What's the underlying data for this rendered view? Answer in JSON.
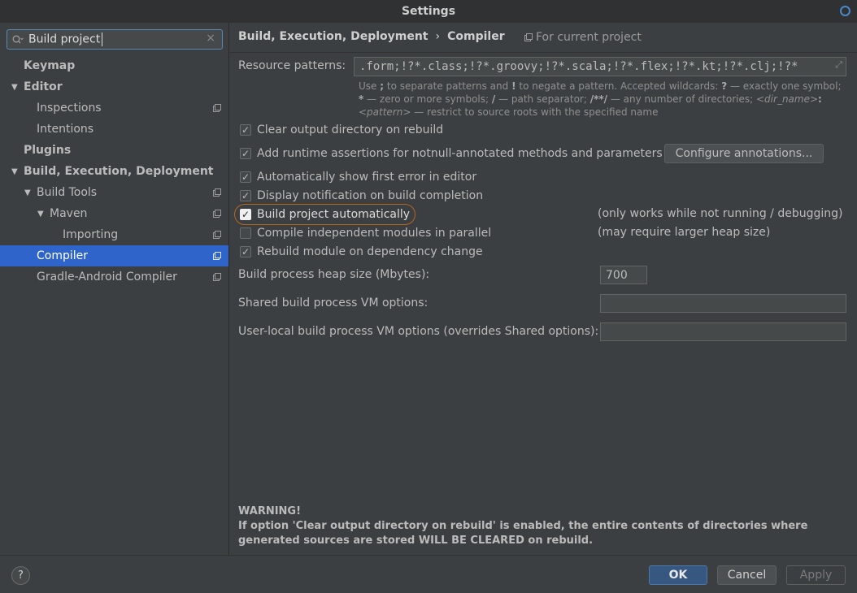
{
  "window": {
    "title": "Settings"
  },
  "search": {
    "value": "Build project",
    "clear_icon": "×"
  },
  "tree": {
    "items": [
      {
        "label": "Keymap",
        "bold": true
      },
      {
        "label": "Editor",
        "bold": true
      },
      {
        "label": "Inspections"
      },
      {
        "label": "Intentions"
      },
      {
        "label": "Plugins",
        "bold": true
      },
      {
        "label": "Build, Execution, Deployment",
        "bold": true
      },
      {
        "label": "Build Tools"
      },
      {
        "label": "Maven"
      },
      {
        "label": "Importing"
      },
      {
        "label": "Compiler",
        "selected": true
      },
      {
        "label": "Gradle-Android Compiler"
      }
    ]
  },
  "header": {
    "crumb1": "Build, Execution, Deployment",
    "separator": "›",
    "crumb2": "Compiler",
    "for_project": "For current project"
  },
  "resource": {
    "label": "Resource patterns:",
    "value": ".form;!?*.class;!?*.groovy;!?*.scala;!?*.flex;!?*.kt;!?*.clj;!?*"
  },
  "hint": {
    "p1": "Use ",
    "semicolon": ";",
    "p2": " to separate patterns and ",
    "bang": "!",
    "p3": " to negate a pattern. Accepted wildcards: ",
    "q": "?",
    "p4": " — exactly one symbol; ",
    "star": "*",
    "p5": " — zero or more symbols; ",
    "slash": "/",
    "p6": " — path separator; ",
    "dstar": "/**/",
    "p7": " — any number of directories; ",
    "dirname": "<dir_name>",
    "colon": ":",
    "pattern": "<pattern>",
    "p8": " — restrict to source roots with the specified name"
  },
  "checks": {
    "clear_output": {
      "label": "Clear output directory on rebuild",
      "checked": true
    },
    "runtime_assertions": {
      "label": "Add runtime assertions for notnull-annotated methods and parameters",
      "checked": true
    },
    "show_first_error": {
      "label": "Automatically show first error in editor",
      "checked": true
    },
    "display_notification": {
      "label": "Display notification on build completion",
      "checked": true
    },
    "build_auto": {
      "label": "Build project automatically",
      "checked": true
    },
    "compile_parallel": {
      "label": "Compile independent modules in parallel",
      "checked": false
    },
    "rebuild_module": {
      "label": "Rebuild module on dependency change",
      "checked": true
    }
  },
  "check_mark": "✓",
  "configure_button": "Configure annotations...",
  "notes": {
    "build_auto": "(only works while not running / debugging)",
    "parallel": "(may require larger heap size)"
  },
  "heap": {
    "label": "Build process heap size (Mbytes):",
    "value": "700"
  },
  "shared_vm": {
    "label": "Shared build process VM options:",
    "value": ""
  },
  "user_vm": {
    "label": "User-local build process VM options (overrides Shared options):",
    "value": ""
  },
  "warning": {
    "title": "WARNING!",
    "text": "If option 'Clear output directory on rebuild' is enabled, the entire contents of directories where generated sources are stored WILL BE CLEARED on rebuild."
  },
  "footer": {
    "help": "?",
    "ok": "OK",
    "cancel": "Cancel",
    "apply": "Apply"
  },
  "colors": {
    "accent": "#2f65ca",
    "ok_button": "#365880",
    "highlight": "#b5651d"
  }
}
